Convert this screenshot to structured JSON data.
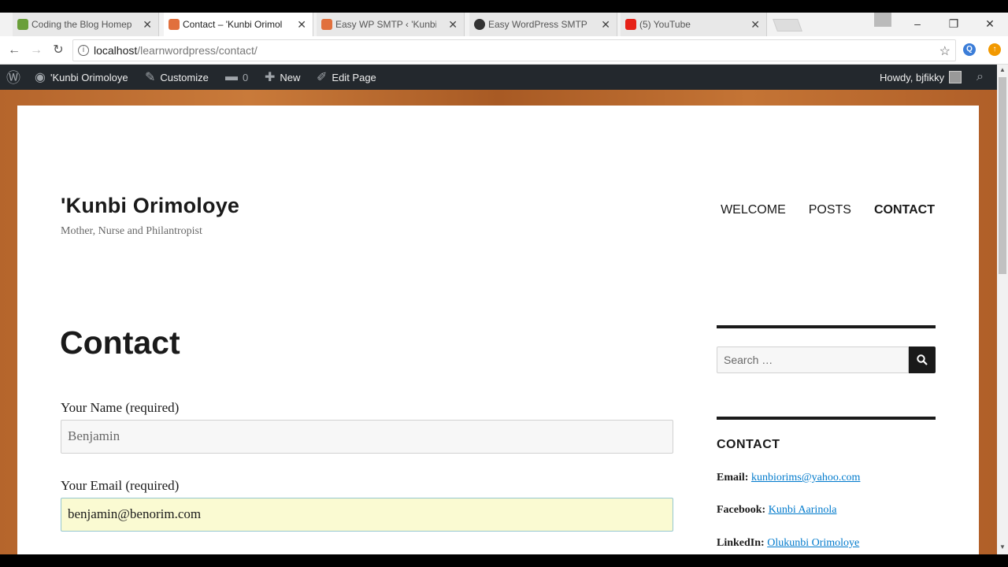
{
  "browser": {
    "tabs": [
      {
        "title": "Coding the Blog Homep",
        "favicon_color": "#6a9f3a",
        "active": false
      },
      {
        "title": "Contact – 'Kunbi Orimol",
        "favicon_color": "#e1703d",
        "active": true
      },
      {
        "title": "Easy WP SMTP ‹ 'Kunbi C",
        "favicon_color": "#e1703d",
        "active": false
      },
      {
        "title": "Easy WordPress SMTP - S",
        "favicon_color": "#333333",
        "active": false
      },
      {
        "title": "(5) YouTube",
        "favicon_color": "#e62117",
        "active": false
      }
    ],
    "url_host": "localhost",
    "url_path": "/learnwordpress/contact/"
  },
  "adminbar": {
    "site_name": "'Kunbi Orimoloye",
    "customize": "Customize",
    "comments_count": "0",
    "new": "New",
    "edit_page": "Edit Page",
    "howdy": "Howdy, bjfikky"
  },
  "site": {
    "title": "'Kunbi Orimoloye",
    "description": "Mother, Nurse and Philantropist",
    "nav": [
      "WELCOME",
      "POSTS",
      "CONTACT"
    ]
  },
  "content": {
    "page_title": "Contact",
    "name_label": "Your Name (required)",
    "name_value": "Benjamin",
    "email_label": "Your Email (required)",
    "email_value": "benjamin@benorim.com"
  },
  "sidebar": {
    "search_placeholder": "Search …",
    "contact_title": "CONTACT",
    "email_label": "Email:",
    "email_value": "kunbiorims@yahoo.com",
    "facebook_label": "Facebook:",
    "facebook_value": "Kunbi Aarinola",
    "linkedin_label": "LinkedIn:",
    "linkedin_value": "Olukunbi Orimoloye"
  },
  "colors": {
    "accent_link": "#007acc",
    "adminbar_bg": "#23282d",
    "autofill_bg": "#fafad2"
  }
}
